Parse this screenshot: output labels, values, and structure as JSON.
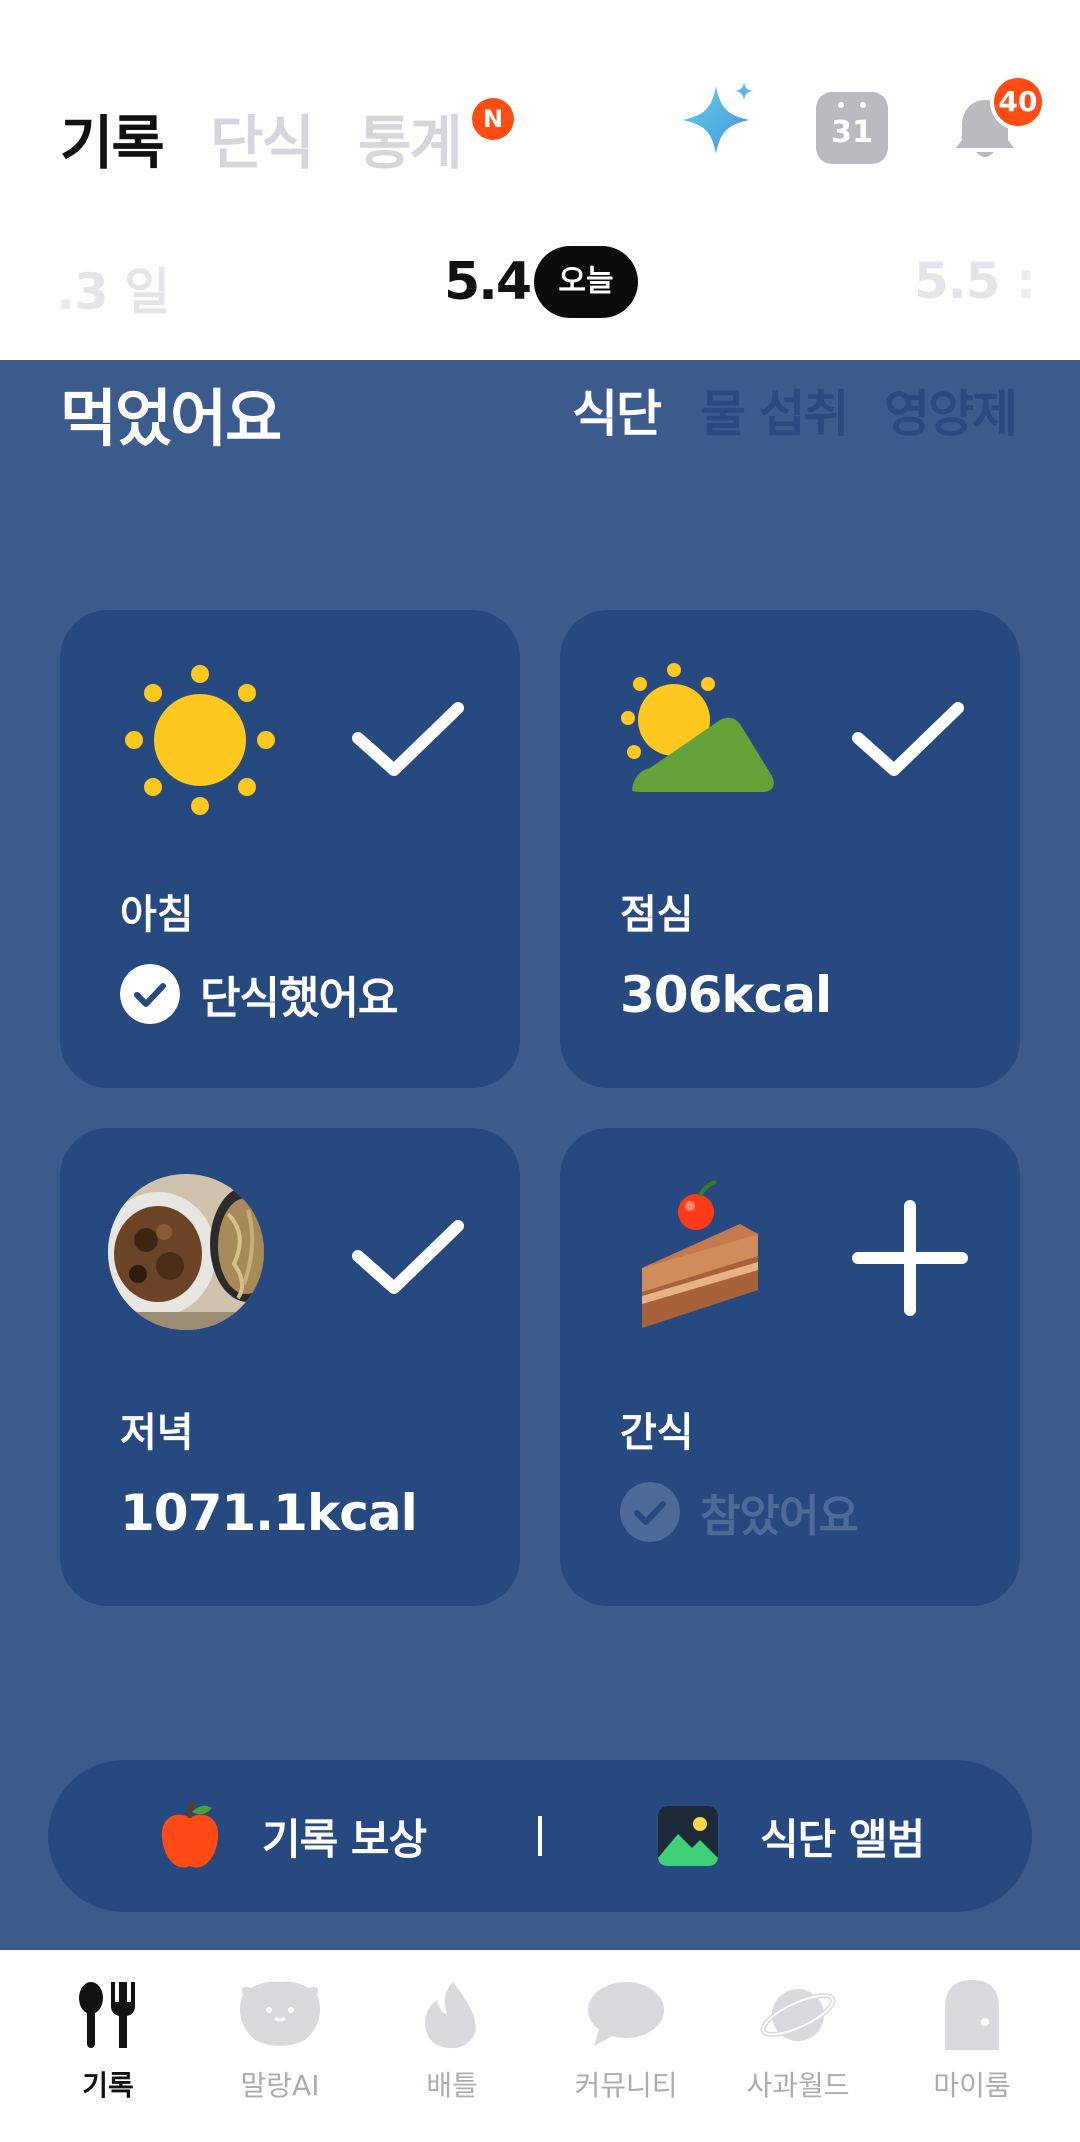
{
  "header": {
    "tabs": [
      {
        "label": "기록",
        "active": true
      },
      {
        "label": "단식",
        "active": false
      },
      {
        "label": "통계",
        "active": false
      }
    ],
    "stats_badge": "N",
    "calendar_day": "31",
    "notification_count": "40",
    "icons": [
      "sparkle-icon",
      "calendar-icon",
      "bell-icon"
    ]
  },
  "date_bar": {
    "prev": ".3 일",
    "current": "5.4",
    "today_label": "오늘",
    "next": "5.5 :"
  },
  "main": {
    "heading": "먹었어요",
    "segments": [
      {
        "label": "식단",
        "active": true
      },
      {
        "label": "물 섭취",
        "active": false
      },
      {
        "label": "영양제",
        "active": false
      }
    ],
    "meals": [
      {
        "label": "아침",
        "status": "단식했어요",
        "action": "check",
        "icon": "sun-icon"
      },
      {
        "label": "점심",
        "value": "306kcal",
        "action": "check",
        "icon": "sun-mountain-icon"
      },
      {
        "label": "저녁",
        "value": "1071.1kcal",
        "action": "check",
        "icon": "food-photo"
      },
      {
        "label": "간식",
        "status": "참았어요",
        "action": "add",
        "icon": "cake-icon"
      }
    ]
  },
  "bottom_pill": {
    "reward_label": "기록 보상",
    "album_label": "식단 앨범"
  },
  "nav": {
    "items": [
      {
        "label": "기록",
        "active": true,
        "icon": "fork-spoon-icon"
      },
      {
        "label": "말랑AI",
        "active": false,
        "icon": "mallang-face-icon"
      },
      {
        "label": "배틀",
        "active": false,
        "icon": "flame-icon"
      },
      {
        "label": "커뮤니티",
        "active": false,
        "icon": "chat-bubble-icon"
      },
      {
        "label": "사과월드",
        "active": false,
        "icon": "planet-icon"
      },
      {
        "label": "마이룸",
        "active": false,
        "icon": "door-icon"
      }
    ]
  },
  "colors": {
    "accent_blue": "#3b5b8c",
    "card_blue": "#264a7f",
    "badge_orange": "#ff4b14"
  }
}
